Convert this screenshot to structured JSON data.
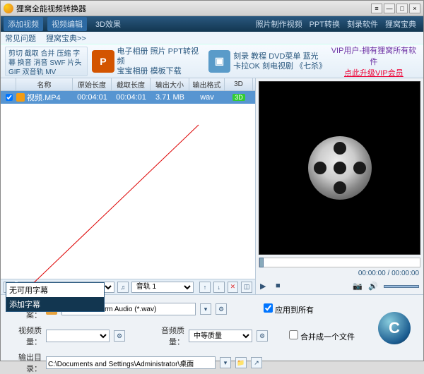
{
  "title": "狸窝全能视频转换器",
  "win_buttons": {
    "min": "—",
    "max": "□",
    "close": "×",
    "menu": "≡"
  },
  "topnav": {
    "left": [
      "添加视频",
      "视频编辑",
      "3D效果"
    ],
    "right": [
      "照片制作视频",
      "PPT转换",
      "刻录软件",
      "狸窝宝典"
    ]
  },
  "toolbar": {
    "btn1": "剪切 截取 合并 压缩 字幕 换音\n消音 SWF 片头 GIF 双音轨 MV",
    "slotA": {
      "line1": "电子相册 照片 PPT转视频",
      "line2": "宝宝相册 模板下载"
    },
    "slotB": {
      "line1": "刻录 教程 DVD菜单 蓝光",
      "line2": "卡拉OK 刻电视剧 《七杀》"
    },
    "vip": {
      "line1": "VIP用户-拥有狸窝所有软件",
      "line2": "点此升级VIP会员"
    }
  },
  "grid_headers": [
    "",
    "名称",
    "原始长度",
    "截取长度",
    "输出大小",
    "输出格式",
    "3D"
  ],
  "row": {
    "name": "视频.MP4",
    "orig": "00:04:01",
    "clip": "00:04:01",
    "size": "3.71 MB",
    "fmt": "wav",
    "threeD": "3D"
  },
  "common_q": "常见问题",
  "baodan": "狸窝宝典>>",
  "subtitle_select": "无可用字幕",
  "dd_items": [
    "无可用字幕",
    "添加字幕"
  ],
  "audio_select": "音轨 1",
  "preview_time": "00:00:00 / 00:00:00",
  "bottom": {
    "preset": "预置方案：",
    "preset_val": "WAV-Waveform Audio (*.wav)",
    "apply_all": "应用到所有",
    "vq": "视频质量：",
    "vq_val": "",
    "aq": "音频质量：",
    "aq_val": "中等质量",
    "merge": "合并成一个文件",
    "out": "输出目录：",
    "out_val": "C:\\Documents and Settings\\Administrator\\桌面"
  },
  "bigbtn": "C"
}
